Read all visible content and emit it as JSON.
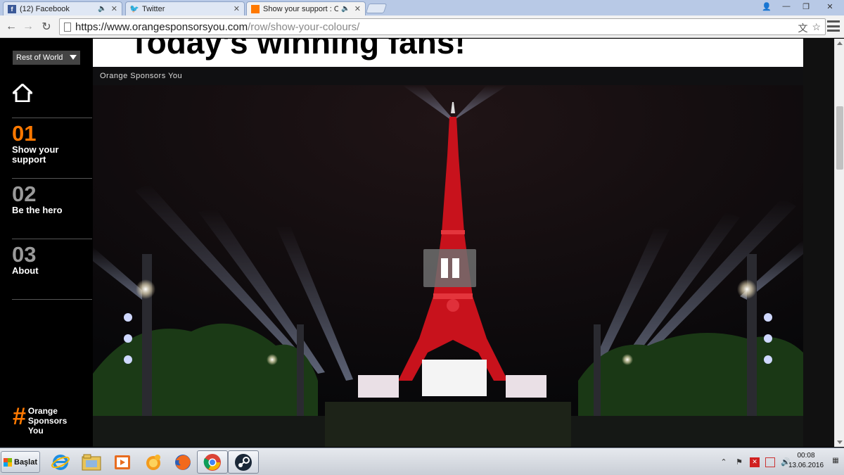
{
  "browser": {
    "tabs": [
      {
        "title": "(12) Facebook",
        "favicon": "facebook-icon",
        "muted_indicator": "🔈",
        "close": "✕"
      },
      {
        "title": "Twitter",
        "favicon": "twitter-icon",
        "close": "✕"
      },
      {
        "title": "Show your support : Orange",
        "favicon": "orange-icon",
        "muted_indicator": "🔈",
        "close": "✕",
        "active": true
      }
    ],
    "window_controls": {
      "user": "👤",
      "minimize": "—",
      "restore": "❐",
      "close": "✕"
    },
    "address": {
      "base": "https://www.orangesponsorsyou.com",
      "path": "/row/show-your-colours/"
    },
    "nav": {
      "back": "←",
      "forward": "→",
      "reload": "↻"
    },
    "omni_actions": {
      "translate": "文",
      "star": "☆"
    }
  },
  "page": {
    "region_selector": "Rest of World",
    "heading": "Today's winning fans!",
    "nav": [
      {
        "num": "01",
        "label": "Show your support",
        "active": true
      },
      {
        "num": "02",
        "label": "Be the hero",
        "active": false
      },
      {
        "num": "03",
        "label": "About",
        "active": false
      }
    ],
    "brand": {
      "hash": "#",
      "text": "Orange Sponsors You"
    },
    "video": {
      "title": "Orange Sponsors You",
      "state": "playing"
    }
  },
  "taskbar": {
    "start_label": "Başlat",
    "apps": [
      "internet-explorer-icon",
      "file-explorer-icon",
      "media-player-icon",
      "messenger-icon",
      "firefox-icon",
      "chrome-icon",
      "steam-icon"
    ],
    "tray": {
      "expand": "⌃",
      "flag": "⚑",
      "volume": "🔊"
    },
    "clock": {
      "time": "00:08",
      "date": "13.06.2016"
    }
  },
  "colors": {
    "accent": "#ff7900",
    "sidebar": "#000000",
    "tower_red": "#d0141e"
  }
}
